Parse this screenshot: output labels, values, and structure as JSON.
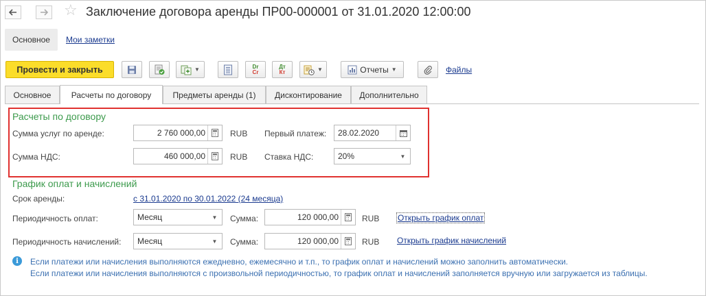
{
  "window": {
    "title": "Заключение договора аренды ПР00-000001 от 31.01.2020 12:00:00"
  },
  "page_tabs": {
    "main": "Основное",
    "notes": "Мои заметки"
  },
  "toolbar": {
    "post_and_close": "Провести и закрыть",
    "reports": "Отчеты",
    "files": "Файлы",
    "dr_top": "Dr",
    "dr_bottom": "Cr",
    "dt_top": "Дт",
    "dt_bottom": "Кт"
  },
  "tabs": [
    {
      "label": "Основное"
    },
    {
      "label": "Расчеты по договору"
    },
    {
      "label": "Предметы аренды (1)"
    },
    {
      "label": "Дисконтирование"
    },
    {
      "label": "Дополнительно"
    }
  ],
  "settlements": {
    "title": "Расчеты по договору",
    "rent_label": "Сумма услуг по аренде:",
    "rent_value": "2 760 000,00",
    "rent_currency": "RUB",
    "vat_label": "Сумма НДС:",
    "vat_value": "460 000,00",
    "vat_currency": "RUB",
    "first_payment_label": "Первый платеж:",
    "first_payment_value": "28.02.2020",
    "vat_rate_label": "Ставка НДС:",
    "vat_rate_value": "20%"
  },
  "schedule": {
    "title": "График оплат и начислений",
    "term_label": "Срок аренды:",
    "term_value": "с 31.01.2020 по 30.01.2022 (24 месяца)",
    "payment_freq_label": "Периодичность оплат:",
    "payment_freq_value": "Месяц",
    "payment_sum_label": "Сумма:",
    "payment_sum_value": "120 000,00",
    "payment_currency": "RUB",
    "open_payment_schedule": "Открыть график оплат",
    "accrual_freq_label": "Периодичность начислений:",
    "accrual_freq_value": "Месяц",
    "accrual_sum_label": "Сумма:",
    "accrual_sum_value": "120 000,00",
    "accrual_currency": "RUB",
    "open_accrual_schedule": "Открыть график начислений"
  },
  "info": {
    "line1": "Если платежи или начисления выполняются ежедневно, ежемесячно и т.п., то график оплат и начислений можно заполнить автоматически.",
    "line2": "Если платежи или начисления выполняются с произвольной периодичностью, то график оплат и начислений заполняется вручную или загружается из таблицы."
  },
  "colors": {
    "accent_yellow": "#fbdd2a",
    "section_green": "#3c9a4c",
    "highlight_red": "#e0312f",
    "link_blue": "#1a3a8f"
  }
}
